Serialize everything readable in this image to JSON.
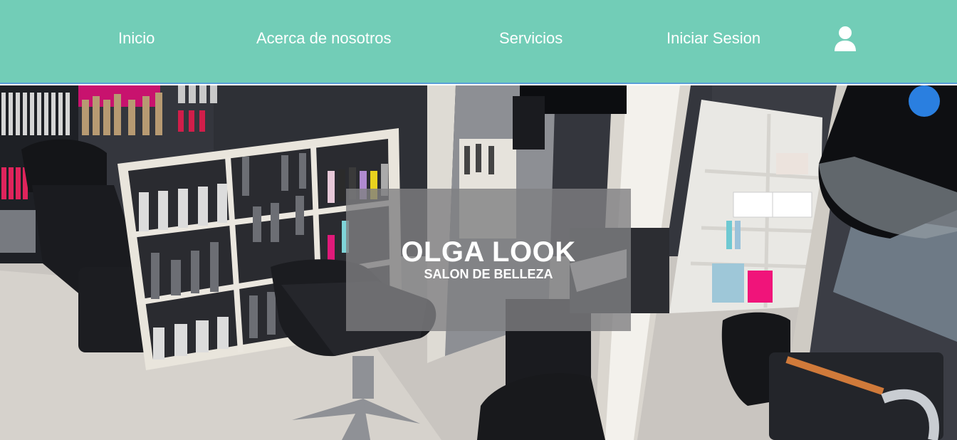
{
  "nav": {
    "items": [
      {
        "label": "Inicio"
      },
      {
        "label": "Acerca de nosotros"
      },
      {
        "label": "Servicios"
      },
      {
        "label": "Iniciar Sesion"
      }
    ],
    "user_icon": "user-icon",
    "background_color": "#72cdb7"
  },
  "hero": {
    "title": "OLGA LOOK",
    "subtitle": "SALON DE BELLEZA",
    "image": "hair-salon-interior"
  }
}
